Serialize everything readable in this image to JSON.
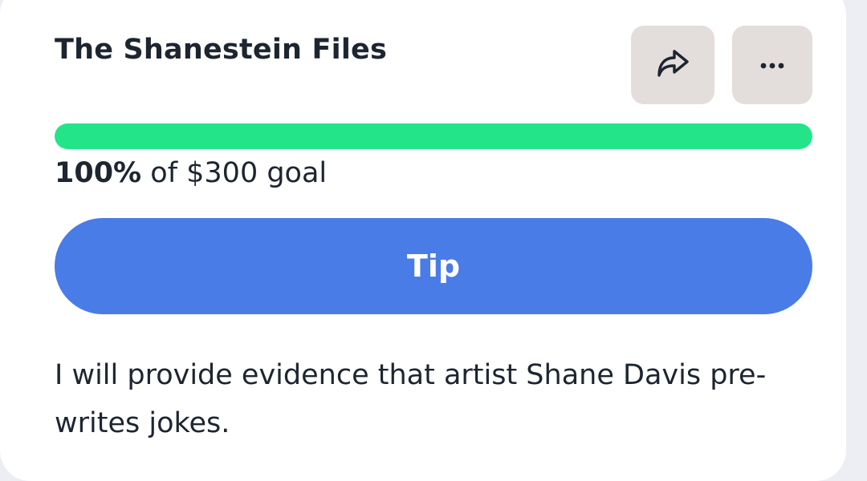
{
  "campaign": {
    "title": "The Shanestein Files",
    "progress_percent": 100,
    "progress_label": "100%",
    "goal_text": "of $300 goal",
    "tip_label": "Tip",
    "description": "I will provide evidence that artist Shane Davis pre-writes jokes."
  },
  "actions": {
    "share_icon": "share-arrow-icon",
    "more_icon": "more-horizontal-icon"
  },
  "colors": {
    "progress": "#24e489",
    "tip_button": "#4a7ce8",
    "icon_button_bg": "#e3dddc",
    "text": "#1d2530"
  }
}
